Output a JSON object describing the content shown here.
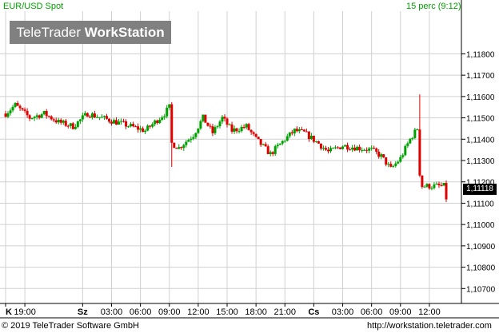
{
  "header": {
    "instrument": "EUR/USD Spot",
    "interval": "15 perc (9:12)"
  },
  "watermark": {
    "brand": "TeleTrader",
    "product": "WorkStation"
  },
  "footer": {
    "copyright": "© 2019 TeleTrader Software GmbH",
    "url": "http://workstation.teletrader.com"
  },
  "colors": {
    "up": "#00a000",
    "down": "#e00000",
    "grid": "#d0d0d0",
    "header_text": "#00a000",
    "watermark_bg": "#808080"
  },
  "chart_data": {
    "type": "candlestick",
    "ylim": [
      1.1063,
      1.12
    ],
    "y_ticks": [
      "1,10700",
      "1,10800",
      "1,10900",
      "1,11000",
      "1,11100",
      "1,11200",
      "1,11300",
      "1,11400",
      "1,11500",
      "1,11600",
      "1,11700",
      "1,11800"
    ],
    "y_tick_values": [
      1.107,
      1.108,
      1.109,
      1.11,
      1.111,
      1.112,
      1.113,
      1.114,
      1.115,
      1.116,
      1.117,
      1.118
    ],
    "last_price": "1,11118",
    "last_price_value": 1.11118,
    "x_ticks": [
      "K",
      "19:00",
      "Sz",
      "03:00",
      "06:00",
      "09:00",
      "12:00",
      "15:00",
      "18:00",
      "21:00",
      "Cs",
      "03:00",
      "06:00",
      "09:00",
      "12:00"
    ],
    "x_tick_bold": [
      true,
      false,
      true,
      false,
      false,
      false,
      false,
      false,
      false,
      false,
      true,
      false,
      false,
      false,
      false
    ],
    "x_tick_index": [
      0,
      8,
      32,
      44,
      56,
      68,
      80,
      92,
      104,
      116,
      128,
      140,
      152,
      164,
      176
    ],
    "candle_count": 184,
    "close_anchors": [
      [
        0,
        1.1152
      ],
      [
        4,
        1.1156
      ],
      [
        10,
        1.115
      ],
      [
        16,
        1.1152
      ],
      [
        22,
        1.1148
      ],
      [
        28,
        1.1146
      ],
      [
        34,
        1.1152
      ],
      [
        40,
        1.115
      ],
      [
        46,
        1.1148
      ],
      [
        52,
        1.1146
      ],
      [
        58,
        1.1144
      ],
      [
        62,
        1.1148
      ],
      [
        66,
        1.1152
      ],
      [
        68,
        1.1155
      ],
      [
        69,
        1.1138
      ],
      [
        72,
        1.1136
      ],
      [
        78,
        1.1142
      ],
      [
        82,
        1.115
      ],
      [
        86,
        1.1143
      ],
      [
        90,
        1.115
      ],
      [
        94,
        1.1144
      ],
      [
        100,
        1.1146
      ],
      [
        104,
        1.114
      ],
      [
        110,
        1.1133
      ],
      [
        116,
        1.114
      ],
      [
        120,
        1.1144
      ],
      [
        124,
        1.1143
      ],
      [
        130,
        1.1138
      ],
      [
        134,
        1.1134
      ],
      [
        140,
        1.1137
      ],
      [
        146,
        1.1136
      ],
      [
        152,
        1.1135
      ],
      [
        156,
        1.1132
      ],
      [
        160,
        1.1126
      ],
      [
        164,
        1.1131
      ],
      [
        168,
        1.114
      ],
      [
        171,
        1.1145
      ],
      [
        172,
        1.1124
      ],
      [
        173,
        1.1118
      ]
    ]
  }
}
